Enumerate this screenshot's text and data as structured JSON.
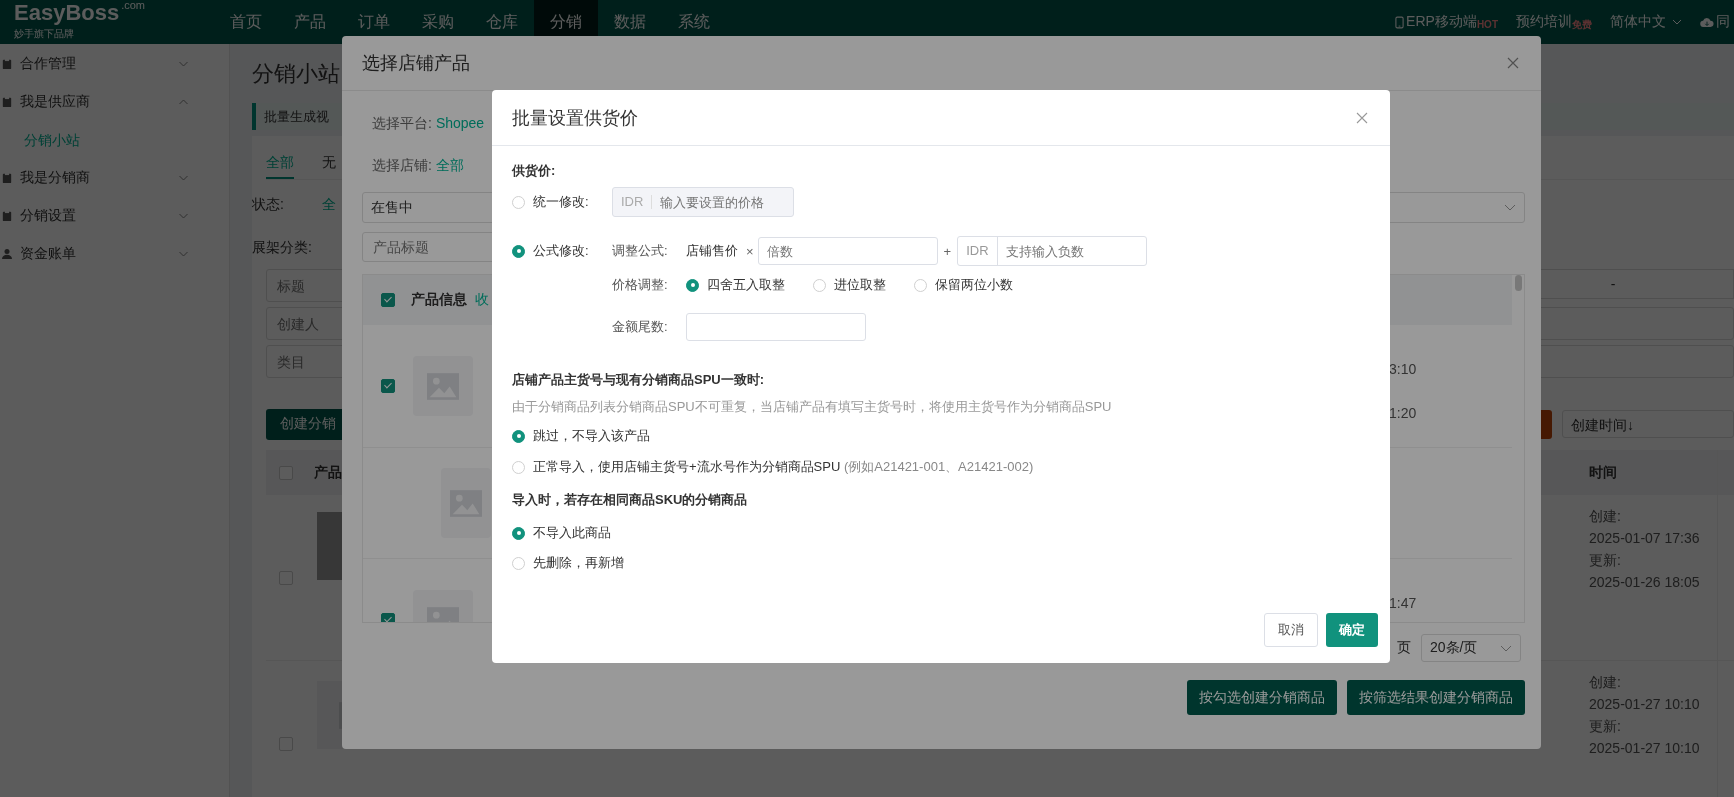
{
  "topbar": {
    "logo": "EasyBoss",
    "logo_domain": ".com",
    "logo_tagline": "妙手旗下品牌",
    "nav": [
      {
        "label": "首页",
        "selected": false
      },
      {
        "label": "产品",
        "selected": false
      },
      {
        "label": "订单",
        "selected": false
      },
      {
        "label": "采购",
        "selected": false
      },
      {
        "label": "仓库",
        "selected": false
      },
      {
        "label": "分销",
        "selected": true
      },
      {
        "label": "数据",
        "selected": false
      },
      {
        "label": "系统",
        "selected": false
      }
    ],
    "links": [
      {
        "label": "ERP移动端",
        "badge": "HOT"
      },
      {
        "label": "预约培训",
        "badge": "免费"
      }
    ],
    "language": "简体中文",
    "cut_item": "同"
  },
  "sidebar": {
    "items": [
      {
        "label": "合作管理",
        "expanded": false
      },
      {
        "label": "我是供应商",
        "expanded": true,
        "children": [
          {
            "label": "分销小站",
            "selected": true
          }
        ]
      },
      {
        "label": "我是分销商",
        "expanded": false
      },
      {
        "label": "分销设置",
        "expanded": false
      },
      {
        "label": "资金账单",
        "expanded": false
      }
    ]
  },
  "page": {
    "title": "分销小站",
    "banner": "批量生成视",
    "tabs": [
      {
        "label": "全部",
        "selected": true
      },
      {
        "label": "无",
        "selected": false
      }
    ],
    "status_label": "状态:",
    "status_value": "全",
    "category_label": "展架分类:",
    "fields": [
      {
        "placeholder": "标题"
      },
      {
        "placeholder": "创建人"
      },
      {
        "placeholder": "类目"
      }
    ],
    "date_separator": "-",
    "create_button": "创建分销",
    "sort": "创建时间↓",
    "table": {
      "all_checked": false,
      "columns": [
        "产品",
        "时间"
      ],
      "rows": [
        {
          "kind": "photo",
          "checked": false,
          "created_label": "创建:",
          "created": "2025-01-07 17:36",
          "updated_label": "更新:",
          "updated": "2025-01-26 18:05"
        },
        {
          "kind": "placeholder",
          "checked": false,
          "created_label": "创建:",
          "created": "2025-01-27 10:10",
          "updated_label": "更新:",
          "updated": "2025-01-27 10:10"
        }
      ]
    }
  },
  "store_modal": {
    "title": "选择店铺产品",
    "platform_label": "选择平台:",
    "platform": "Shopee",
    "store_label": "选择店铺:",
    "store": "全部",
    "status_select": "在售中",
    "title_field": {
      "placeholder": "产品标题"
    },
    "all_checked": true,
    "column": "产品信息",
    "collapse_link": "收",
    "rows": [
      {
        "kind": "product",
        "checked": true,
        "times": [
          "3:10",
          "1:20"
        ]
      },
      {
        "kind": "variant",
        "times": []
      },
      {
        "kind": "product",
        "checked": true,
        "times": [
          "1:47"
        ]
      }
    ],
    "page_suffix": "页",
    "page_size": "20条/页",
    "buttons": [
      "按勾选创建分销商品",
      "按筛选结果创建分销商品"
    ]
  },
  "dialog": {
    "title": "批量设置供货价",
    "price_title": "供货价:",
    "uniform": {
      "label": "统一修改:",
      "selected": false,
      "currency": "IDR",
      "placeholder": "输入要设置的价格"
    },
    "formula": {
      "label": "公式修改:",
      "selected": true,
      "formula_label": "调整公式:",
      "base": "店铺售价",
      "times": "×",
      "multiplier_placeholder": "倍数",
      "plus": "+",
      "currency": "IDR",
      "offset_placeholder": "支持输入负数",
      "rounding_label": "价格调整:",
      "rounding": [
        {
          "label": "四舍五入取整",
          "selected": true
        },
        {
          "label": "进位取整",
          "selected": false
        },
        {
          "label": "保留两位小数",
          "selected": false
        }
      ],
      "tail_label": "金额尾数:"
    },
    "spu": {
      "title": "店铺产品主货号与现有分销商品SPU一致时:",
      "hint": "由于分销商品列表分销商品SPU不可重复，当店铺产品有填写主货号时，将使用主货号作为分销商品SPU",
      "options": [
        {
          "label": "跳过，不导入该产品",
          "selected": true
        },
        {
          "label": "正常导入，使用店铺主货号+流水号作为分销商品SPU",
          "note": "(例如A21421-001、A21421-002)",
          "selected": false
        }
      ]
    },
    "sku": {
      "title": "导入时，若存在相同商品SKU的分销商品",
      "options": [
        {
          "label": "不导入此商品",
          "selected": true
        },
        {
          "label": "先删除，再新增",
          "selected": false
        }
      ]
    },
    "cancel": "取消",
    "confirm": "确定"
  }
}
